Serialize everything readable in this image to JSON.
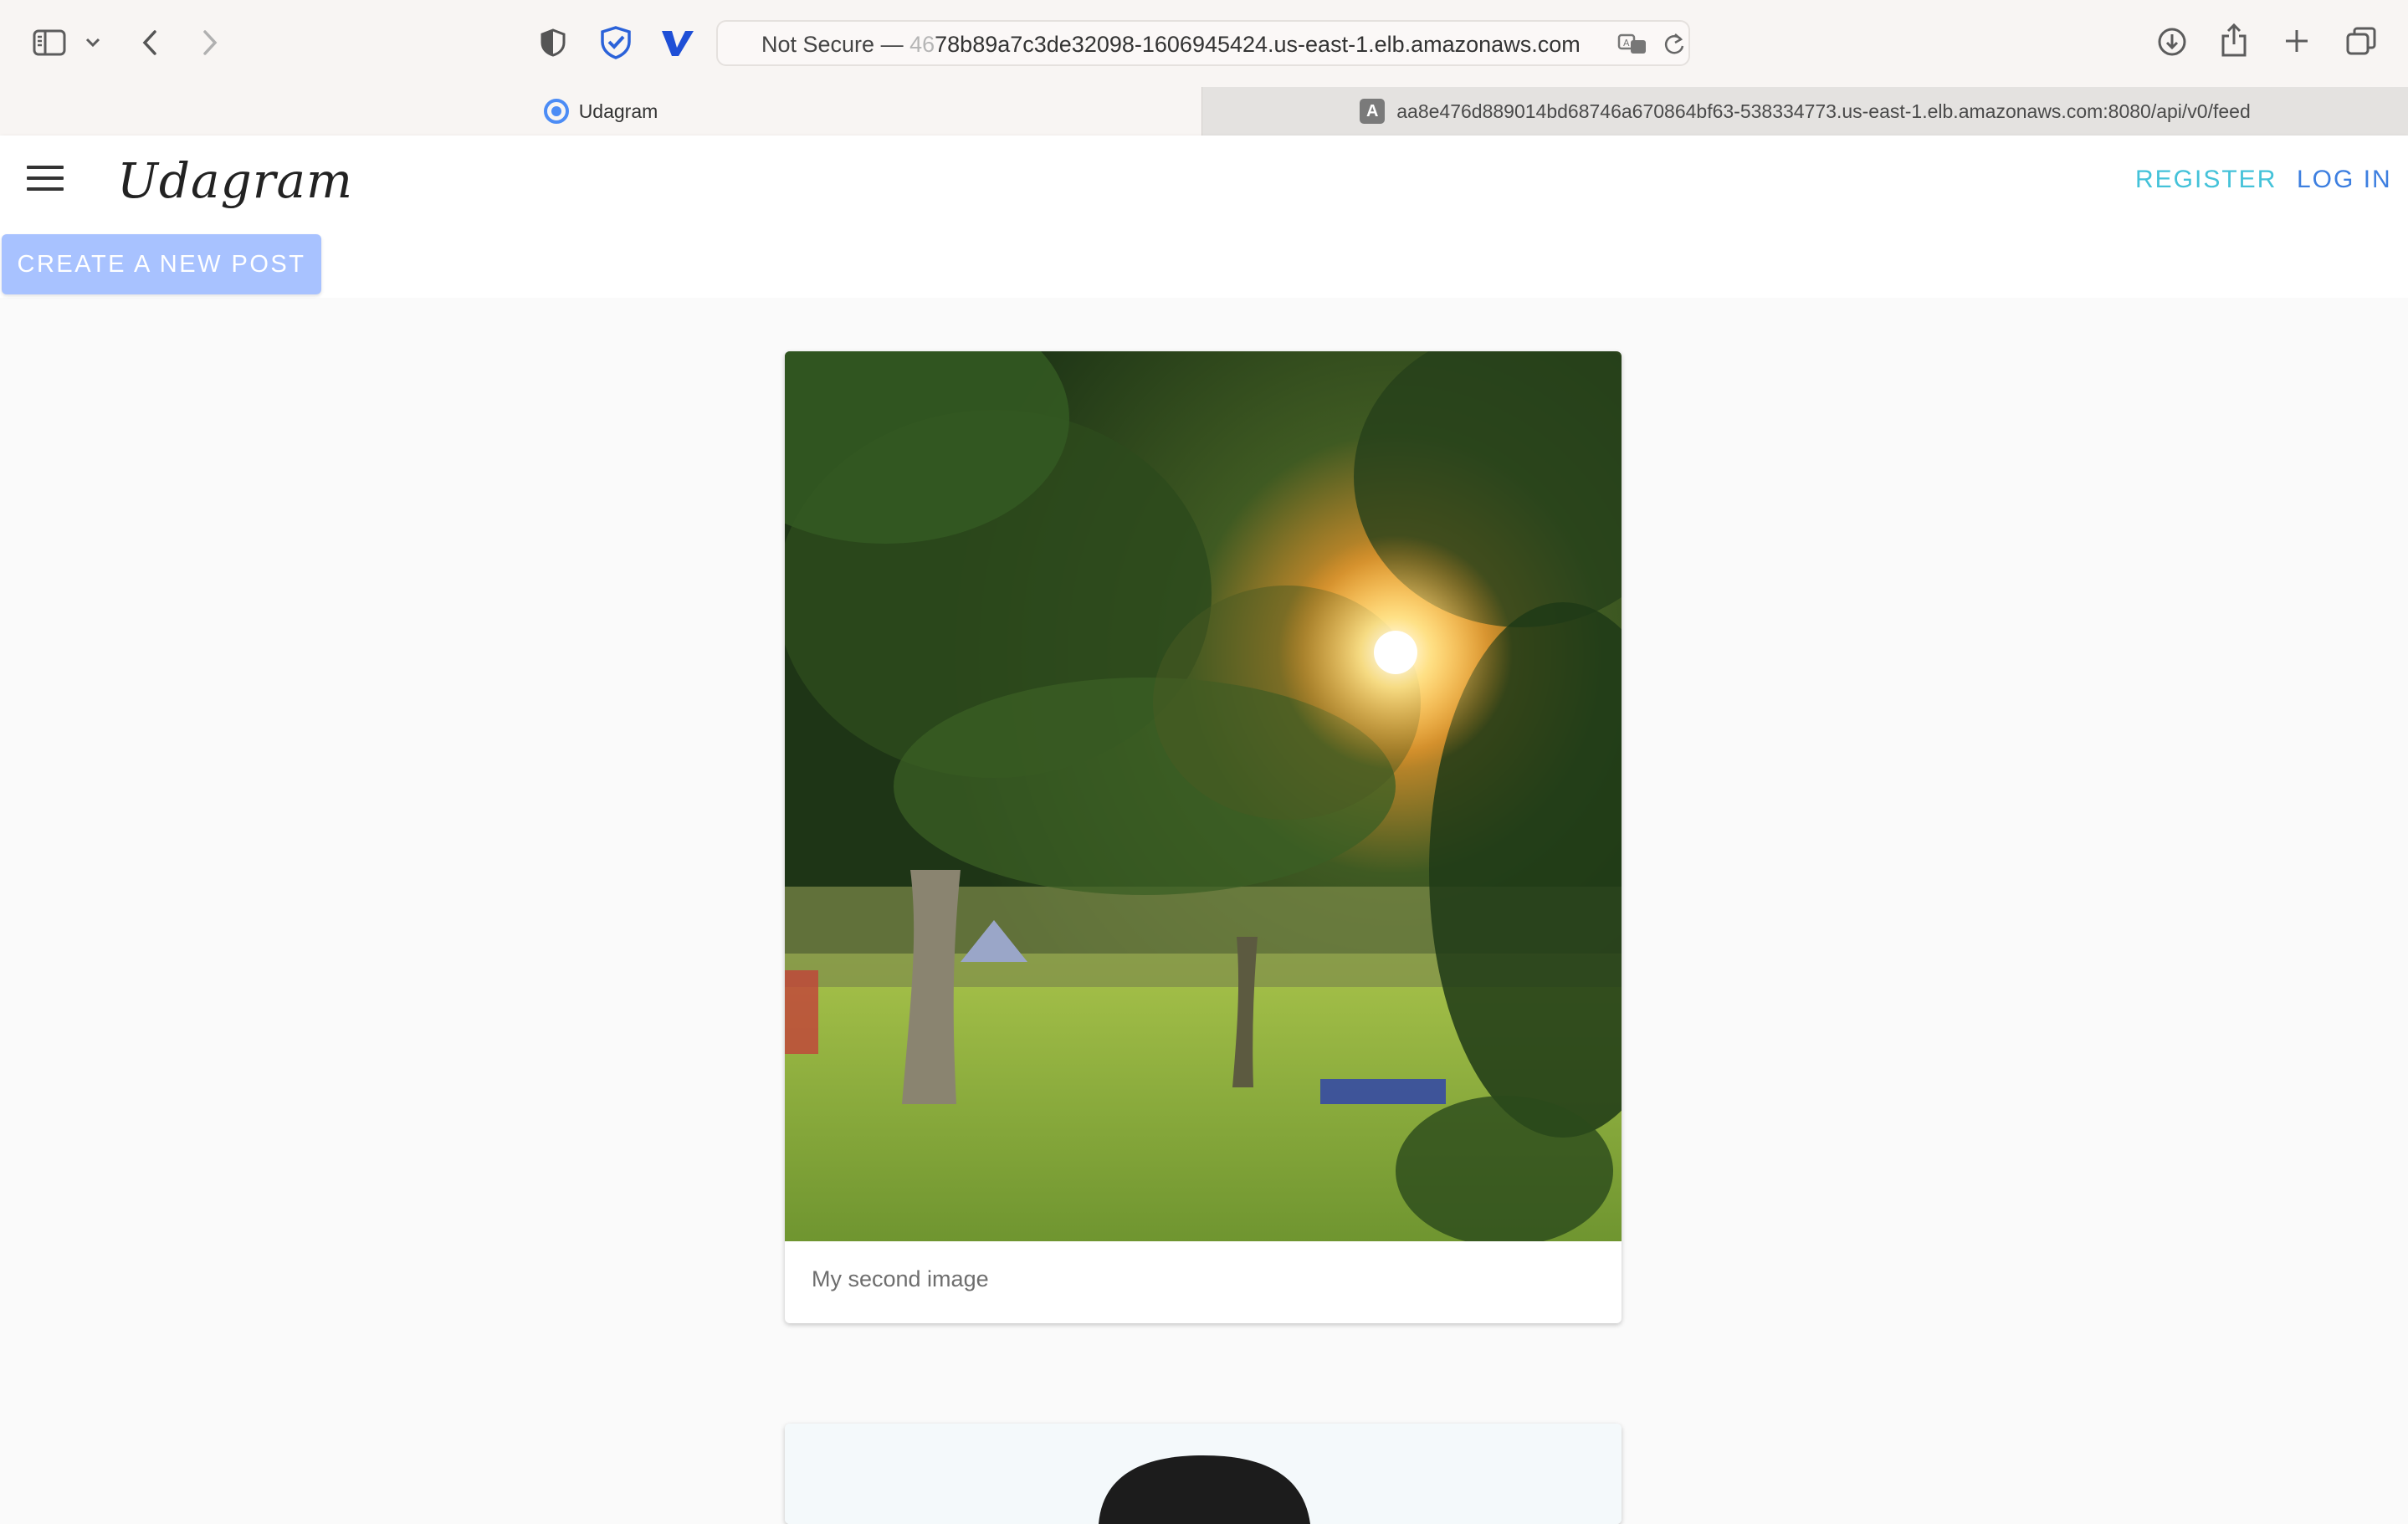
{
  "browser": {
    "address_bar": {
      "security_label": "Not Secure —",
      "url_faded": "46",
      "url_host": "78b89a7c3de32098-1606945424.us-east-1.elb.amazonaws.com"
    },
    "tabs": [
      {
        "title": "Udagram",
        "active": true
      },
      {
        "title": "aa8e476d889014bd68746a670864bf63-538334773.us-east-1.elb.amazonaws.com:8080/api/v0/feed",
        "active": false,
        "favicon_letter": "A"
      }
    ],
    "toolbar_icons": [
      "sidebar-icon",
      "chevron-down-icon",
      "back-icon",
      "forward-icon",
      "privacy-shield-icon",
      "bitwarden-shield-icon",
      "v-extension-icon",
      "translate-icon",
      "reload-icon",
      "download-icon",
      "share-icon",
      "new-tab-icon",
      "tab-overview-icon"
    ]
  },
  "app": {
    "brand": "Udagram",
    "nav": {
      "register": "REGISTER",
      "login": "LOG IN"
    },
    "create_post_label": "CREATE A NEW POST",
    "feed": [
      {
        "caption": "My second image",
        "image": "sunlit-trees-park-photo"
      },
      {
        "caption": "",
        "image": "person-portrait-photo"
      }
    ]
  },
  "colors": {
    "register": "#44c2d9",
    "login": "#3d7fe0",
    "create_button_bg": "#a8c2ff"
  }
}
